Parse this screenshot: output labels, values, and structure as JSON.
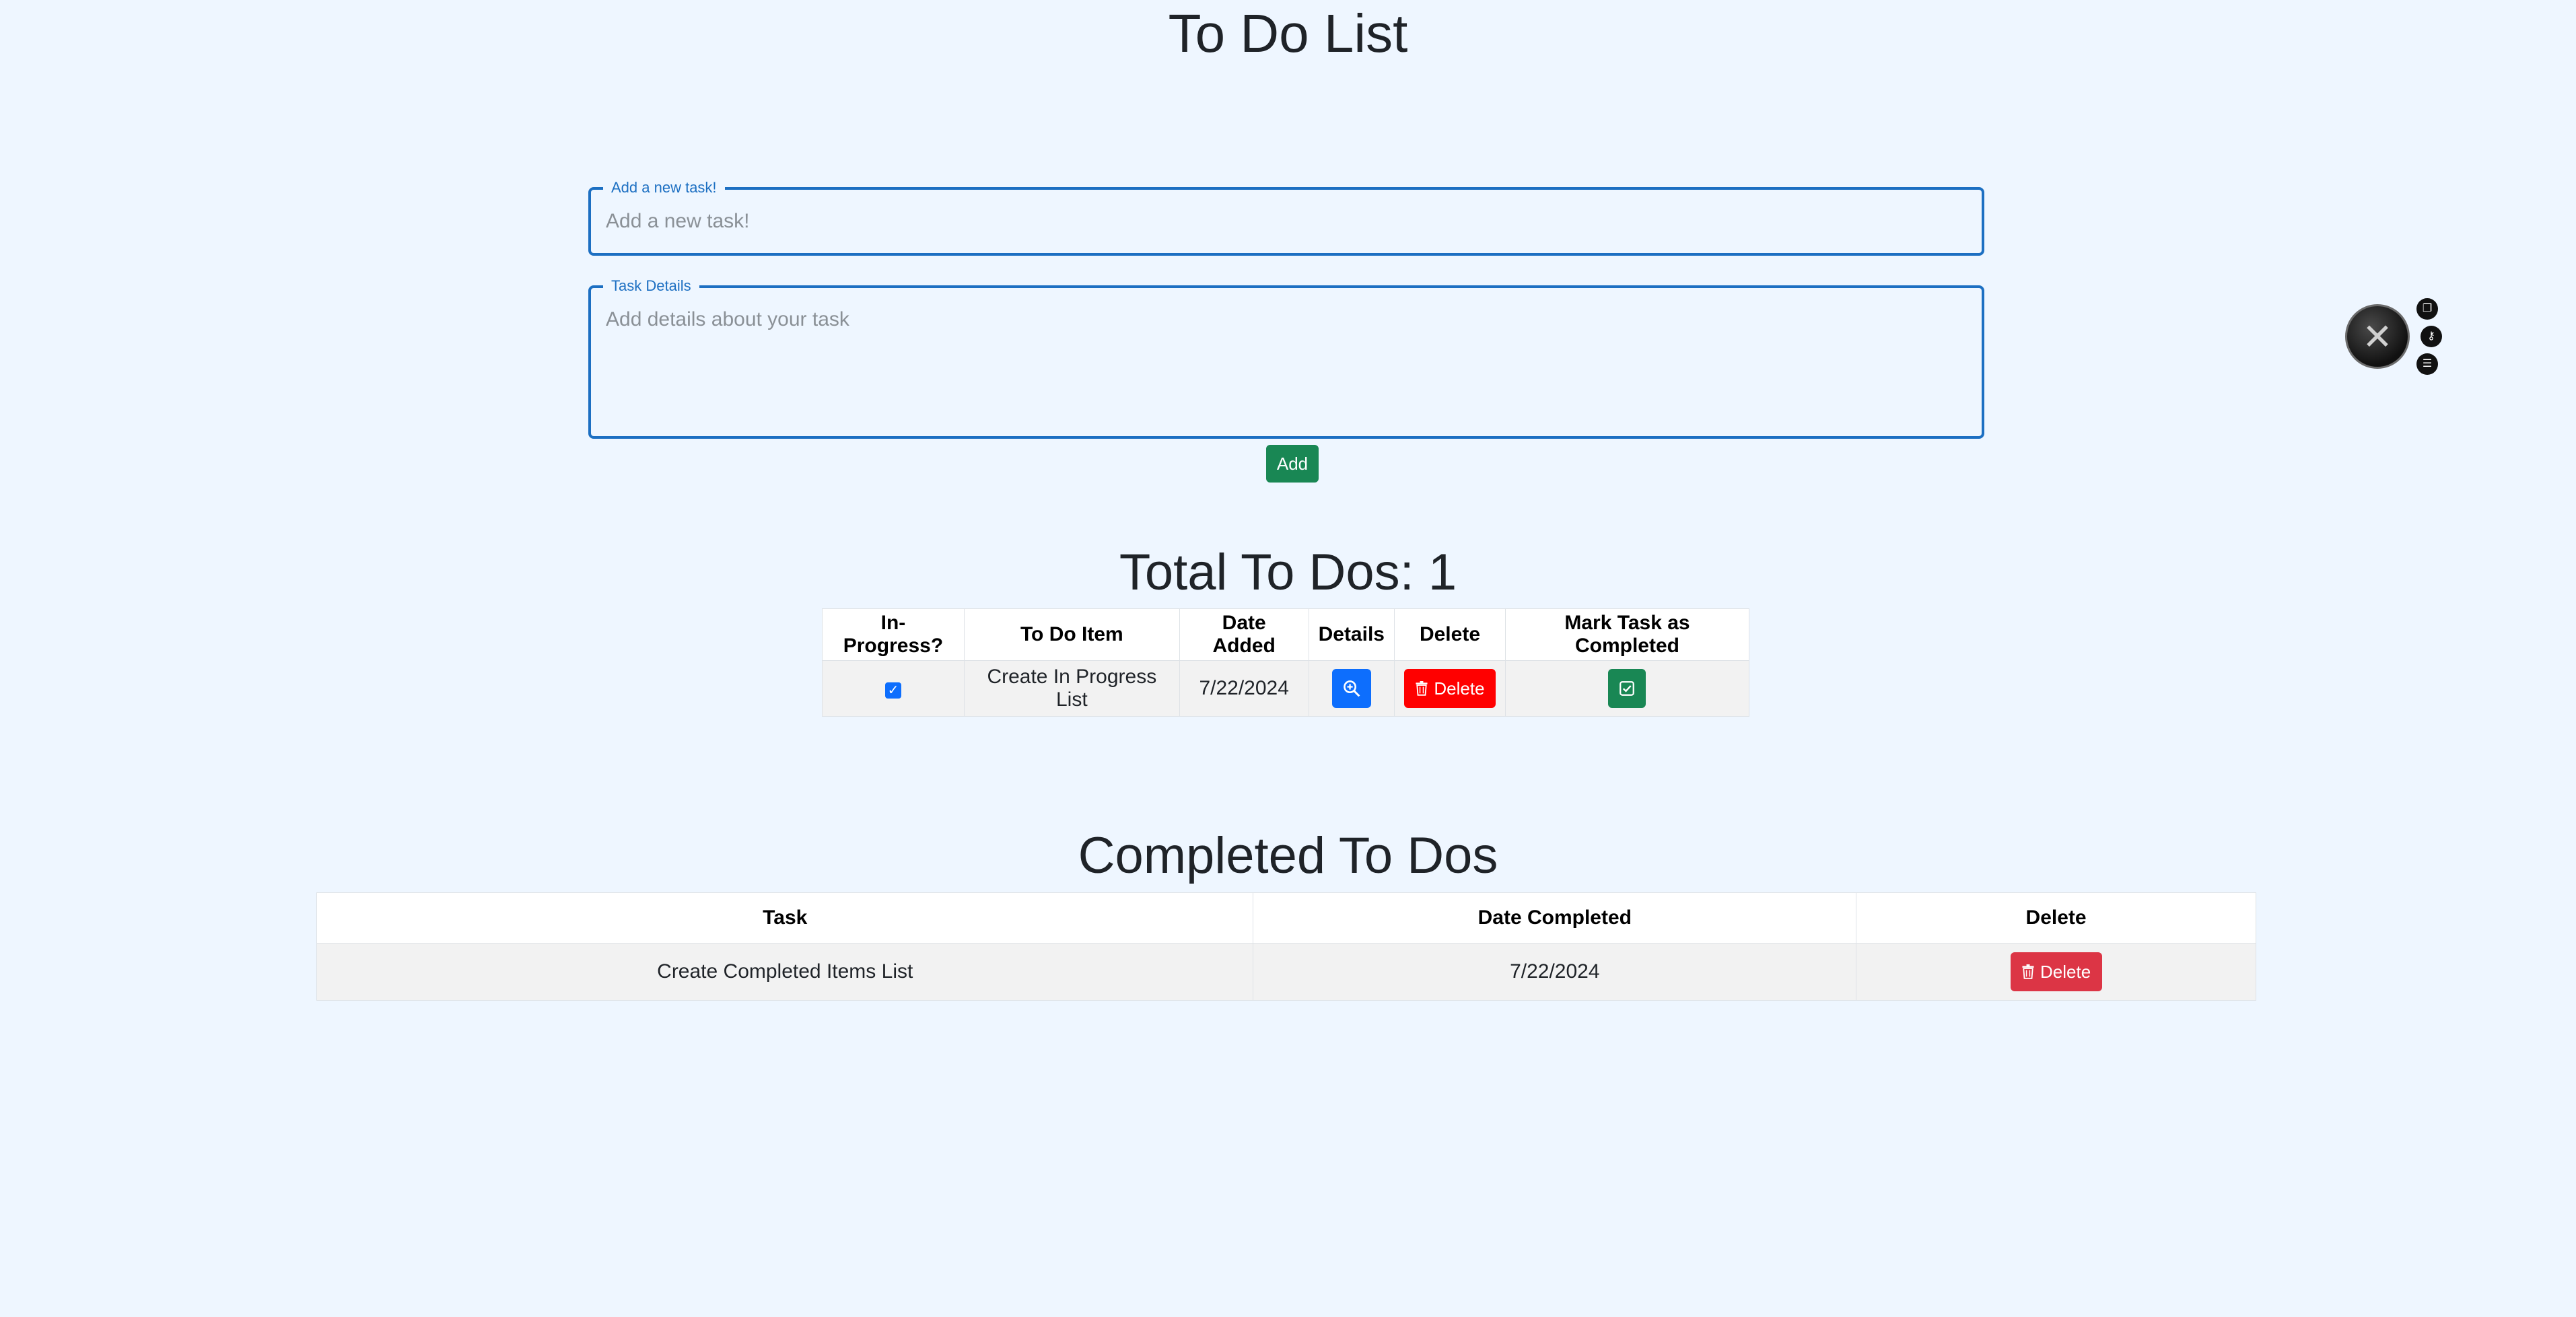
{
  "page": {
    "title": "To Do List"
  },
  "form": {
    "task_legend": "Add a new task!",
    "task_placeholder": "Add a new task!",
    "task_value": "",
    "details_legend": "Task Details",
    "details_placeholder": "Add details about your task",
    "details_value": "",
    "add_label": "Add"
  },
  "todos": {
    "title": "Total To Dos: 1",
    "headers": [
      "In-Progress?",
      "To Do Item",
      "Date Added",
      "Details",
      "Delete",
      "Mark Task as Completed"
    ],
    "rows": [
      {
        "in_progress": true,
        "item": "Create In Progress List",
        "date_added": "7/22/2024",
        "delete_label": "Delete"
      }
    ]
  },
  "completed": {
    "title": "Completed To Dos",
    "headers": [
      "Task",
      "Date Completed",
      "Delete"
    ],
    "rows": [
      {
        "task": "Create Completed Items List",
        "date_completed": "7/22/2024",
        "delete_label": "Delete"
      }
    ]
  },
  "icons": {
    "details": "magnifier-plus-icon",
    "delete": "trash-icon",
    "complete": "check-square-icon",
    "widget": "assistant-logo-icon"
  },
  "colors": {
    "background": "#eef6ff",
    "primary": "#0d6efd",
    "success": "#198754",
    "delete_red": "#ff0000",
    "danger": "#dc3545",
    "field_border": "#1c6fc2"
  }
}
